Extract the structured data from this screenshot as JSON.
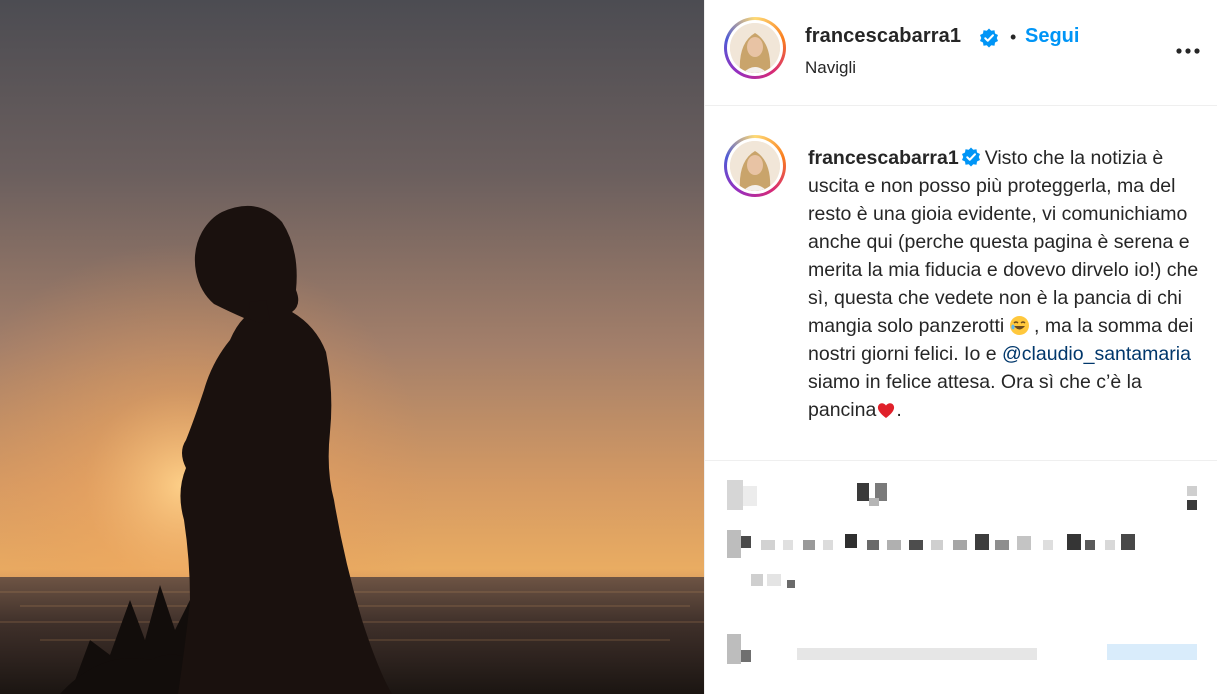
{
  "post": {
    "author": {
      "username": "francescabarra1",
      "verified": true,
      "follow_label": "Segui",
      "separator": "•",
      "location": "Navigli"
    },
    "caption": {
      "username": "francescabarra1",
      "part1": "Visto che la notizia è uscita e non posso più proteggerla, ma del resto è una gioia evidente, vi comunichiamo anche qui (perche questa pagina è serena e merita la mia fiducia e dovevo dirvelo io!) che sì, questa che vedete non è la pancia di chi mangia solo panzerotti",
      "part2": ", ma la somma dei nostri giorni felici. Io e",
      "mention": "@claudio_santamaria",
      "part3": "siamo in felice attesa. Ora sì che c’è la pancina",
      "part4": "."
    },
    "icons": {
      "verified": "verified-badge-icon",
      "more": "more-options-icon",
      "laugh_emoji": "rolling-on-floor-laughing-emoji",
      "heart_emoji": "red-heart-emoji"
    },
    "colors": {
      "follow": "#0095f6",
      "verified": "#0095f6",
      "mention": "#00376b"
    }
  }
}
